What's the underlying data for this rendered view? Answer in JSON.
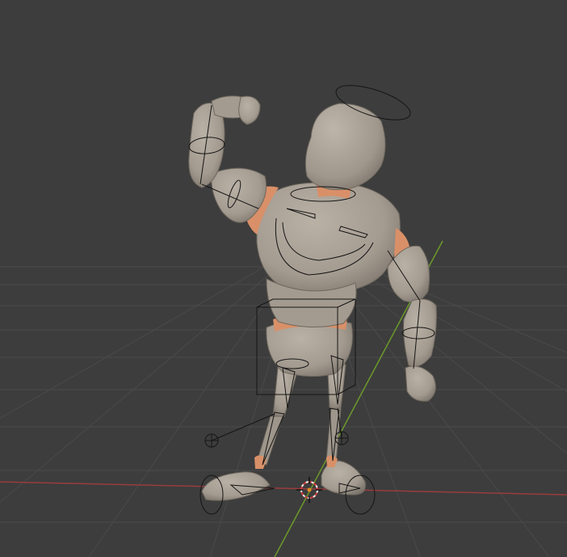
{
  "viewport": {
    "background": "#3d3d3d",
    "grid_color": "#4a4a4a",
    "x_axis_color": "#9a3c3c",
    "y_axis_color": "#6b9a2a"
  },
  "scene": {
    "character": {
      "skin_color": "#a9a095",
      "skin_shadow": "#7d766d",
      "flesh_color": "#d99068",
      "pose": "flexing"
    },
    "rig": {
      "line_color": "#151515"
    },
    "cursor": {
      "icon": "3d-cursor-icon",
      "color_a": "#d23b3b",
      "color_b": "#f2f2f2"
    }
  }
}
